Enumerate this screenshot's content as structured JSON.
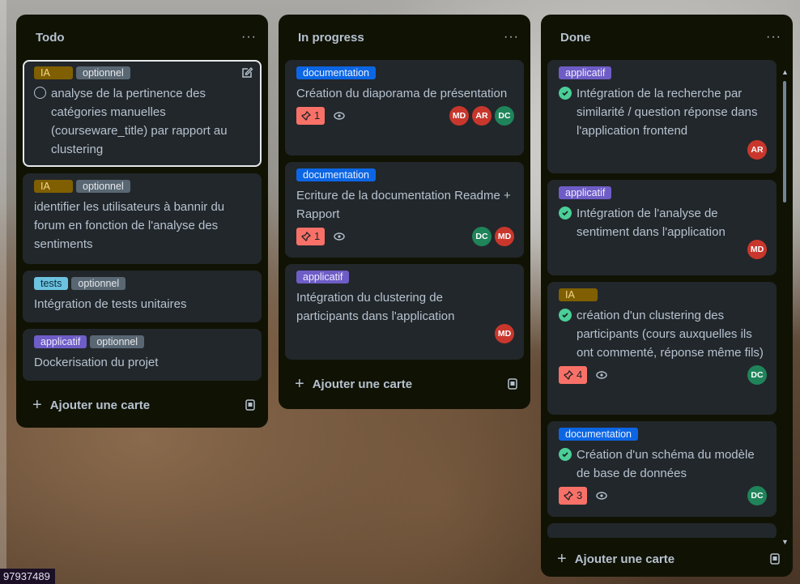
{
  "columns": [
    {
      "title": "Todo",
      "menu": "···",
      "add_label": "Ajouter une carte",
      "cards": [
        {
          "labels": [
            "IA",
            "optionnel"
          ],
          "title": "analyse de la pertinence des catégories manuelles (courseware_title) par rapport au clustering"
        },
        {
          "labels": [
            "IA",
            "optionnel"
          ],
          "title": "identifier les utilisateurs à bannir du forum en fonction de l'analyse des sentiments"
        },
        {
          "labels": [
            "tests",
            "optionnel"
          ],
          "title": "Intégration de tests unitaires"
        },
        {
          "labels": [
            "applicatif",
            "optionnel"
          ],
          "title": "Dockerisation du projet"
        }
      ]
    },
    {
      "title": "In progress",
      "menu": "···",
      "add_label": "Ajouter une carte",
      "cards": [
        {
          "labels": [
            "documentation"
          ],
          "title": "Création du diaporama de présentation",
          "due": "1",
          "avatars": [
            "MD",
            "AR",
            "DC"
          ]
        },
        {
          "labels": [
            "documentation"
          ],
          "title": "Ecriture de la documentation Readme + Rapport",
          "due": "1",
          "avatars": [
            "DC",
            "MD"
          ]
        },
        {
          "labels": [
            "applicatif"
          ],
          "title": "Intégration du clustering de participants dans l'application",
          "avatars": [
            "MD"
          ]
        }
      ]
    },
    {
      "title": "Done",
      "menu": "···",
      "add_label": "Ajouter une carte",
      "cards": [
        {
          "labels": [
            "applicatif"
          ],
          "title": "Intégration de la recherche par similarité / question réponse dans l'application frontend",
          "avatars": [
            "AR"
          ]
        },
        {
          "labels": [
            "applicatif"
          ],
          "title": "Intégration de l'analyse de sentiment dans l'application",
          "avatars": [
            "MD"
          ]
        },
        {
          "labels": [
            "IA"
          ],
          "title": "création d'un clustering des participants (cours auxquelles ils ont commenté, réponse même fils)",
          "due": "4",
          "avatars": [
            "DC"
          ]
        },
        {
          "labels": [
            "documentation"
          ],
          "title": "Création d'un schéma du modèle de base de données",
          "due": "3",
          "avatars": [
            "DC"
          ]
        }
      ]
    }
  ],
  "avatar_colors": {
    "MD": "#c9372c",
    "AR": "#c9372c",
    "DC": "#1f845a"
  },
  "bottom_tag": "97937489"
}
